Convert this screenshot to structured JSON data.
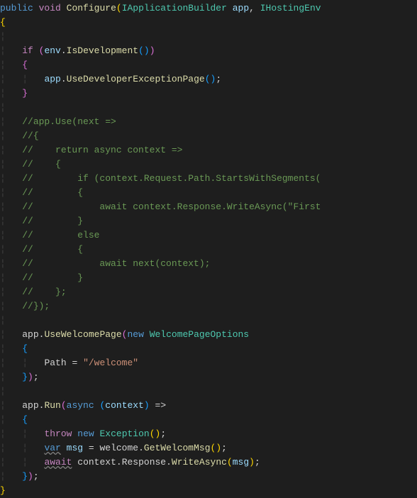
{
  "code": {
    "l1": {
      "public": "public",
      "void": "void",
      "name": "Configure",
      "t1": "IApplicationBuilder",
      "p1": "app",
      "t2": "IHostingEnv"
    },
    "l2": {
      "brace": "{"
    },
    "l4": {
      "if": "if",
      "env": "env",
      "dot": ".",
      "isdev": "IsDevelopment"
    },
    "l5": {
      "brace": "{"
    },
    "l6": {
      "app": "app",
      "use": "UseDeveloperExceptionPage"
    },
    "l7": {
      "brace": "}"
    },
    "l9": "//app.Use(next =>",
    "l10": "//{",
    "l11": "//    return async context =>",
    "l12": "//    {",
    "l13": "//        if (context.Request.Path.StartsWithSegments(",
    "l14": "//        {",
    "l15": "//            await context.Response.WriteAsync(\"First",
    "l16": "//        }",
    "l17": "//        else",
    "l18": "//        {",
    "l19": "//            await next(context);",
    "l20": "//        }",
    "l21": "//    };",
    "l22": "//});",
    "l24": {
      "app": "app",
      "uwp": "UseWelcomePage",
      "new": "new",
      "type": "WelcomePageOptions"
    },
    "l25": {
      "brace": "{"
    },
    "l26": {
      "path": "Path",
      "eq": " = ",
      "val": "\"/welcome\""
    },
    "l27": {
      "brace": "}",
      "close": ");"
    },
    "l29": {
      "app": "app",
      "run": "Run",
      "async": "async",
      "ctx": "context",
      "arrow": " =>"
    },
    "l30": {
      "brace": "{"
    },
    "l31": {
      "throw": "throw",
      "new": "new",
      "exc": "Exception"
    },
    "l32": {
      "var": "var",
      "msg": "msg",
      "eq": " = ",
      "w": "welcome",
      "get": "GetWelcomMsg"
    },
    "l33": {
      "await": "await",
      "ctx": "context",
      "resp": "Response",
      "wa": "WriteAsync",
      "arg": "msg"
    },
    "l34": {
      "brace": "}",
      "close": ");"
    },
    "l35": {
      "brace": "}"
    }
  }
}
